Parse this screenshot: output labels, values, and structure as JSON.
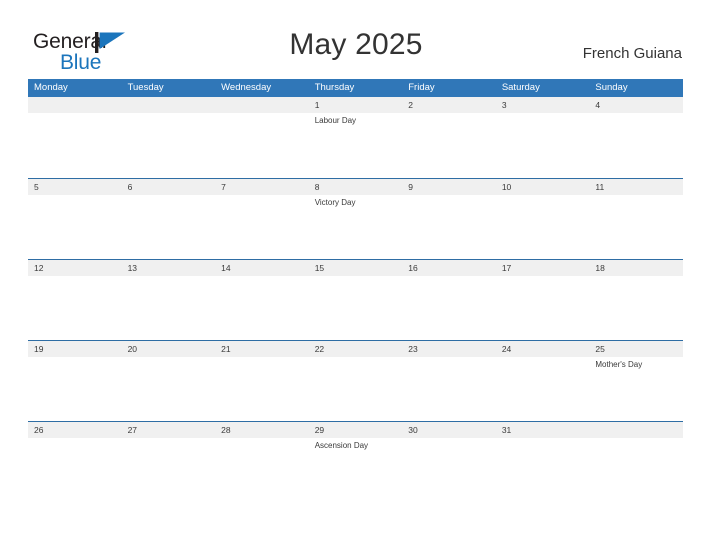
{
  "brand": {
    "name_part1": "General",
    "name_part2": "Blue",
    "flag_icon": "blue-triangle-flag-icon",
    "color_dark": "#231f20",
    "color_blue": "#1b75bc"
  },
  "header": {
    "month_title": "May 2025",
    "region": "French Guiana"
  },
  "calendar": {
    "accent_color": "#3077b8",
    "band_color": "#f0f0f0",
    "weekdays": [
      "Monday",
      "Tuesday",
      "Wednesday",
      "Thursday",
      "Friday",
      "Saturday",
      "Sunday"
    ],
    "weeks": [
      {
        "days": [
          {
            "date": "",
            "event": ""
          },
          {
            "date": "",
            "event": ""
          },
          {
            "date": "",
            "event": ""
          },
          {
            "date": "1",
            "event": "Labour Day"
          },
          {
            "date": "2",
            "event": ""
          },
          {
            "date": "3",
            "event": ""
          },
          {
            "date": "4",
            "event": ""
          }
        ]
      },
      {
        "days": [
          {
            "date": "5",
            "event": ""
          },
          {
            "date": "6",
            "event": ""
          },
          {
            "date": "7",
            "event": ""
          },
          {
            "date": "8",
            "event": "Victory Day"
          },
          {
            "date": "9",
            "event": ""
          },
          {
            "date": "10",
            "event": ""
          },
          {
            "date": "11",
            "event": ""
          }
        ]
      },
      {
        "days": [
          {
            "date": "12",
            "event": ""
          },
          {
            "date": "13",
            "event": ""
          },
          {
            "date": "14",
            "event": ""
          },
          {
            "date": "15",
            "event": ""
          },
          {
            "date": "16",
            "event": ""
          },
          {
            "date": "17",
            "event": ""
          },
          {
            "date": "18",
            "event": ""
          }
        ]
      },
      {
        "days": [
          {
            "date": "19",
            "event": ""
          },
          {
            "date": "20",
            "event": ""
          },
          {
            "date": "21",
            "event": ""
          },
          {
            "date": "22",
            "event": ""
          },
          {
            "date": "23",
            "event": ""
          },
          {
            "date": "24",
            "event": ""
          },
          {
            "date": "25",
            "event": "Mother's Day"
          }
        ]
      },
      {
        "days": [
          {
            "date": "26",
            "event": ""
          },
          {
            "date": "27",
            "event": ""
          },
          {
            "date": "28",
            "event": ""
          },
          {
            "date": "29",
            "event": "Ascension Day"
          },
          {
            "date": "30",
            "event": ""
          },
          {
            "date": "31",
            "event": ""
          },
          {
            "date": "",
            "event": ""
          }
        ]
      }
    ]
  }
}
